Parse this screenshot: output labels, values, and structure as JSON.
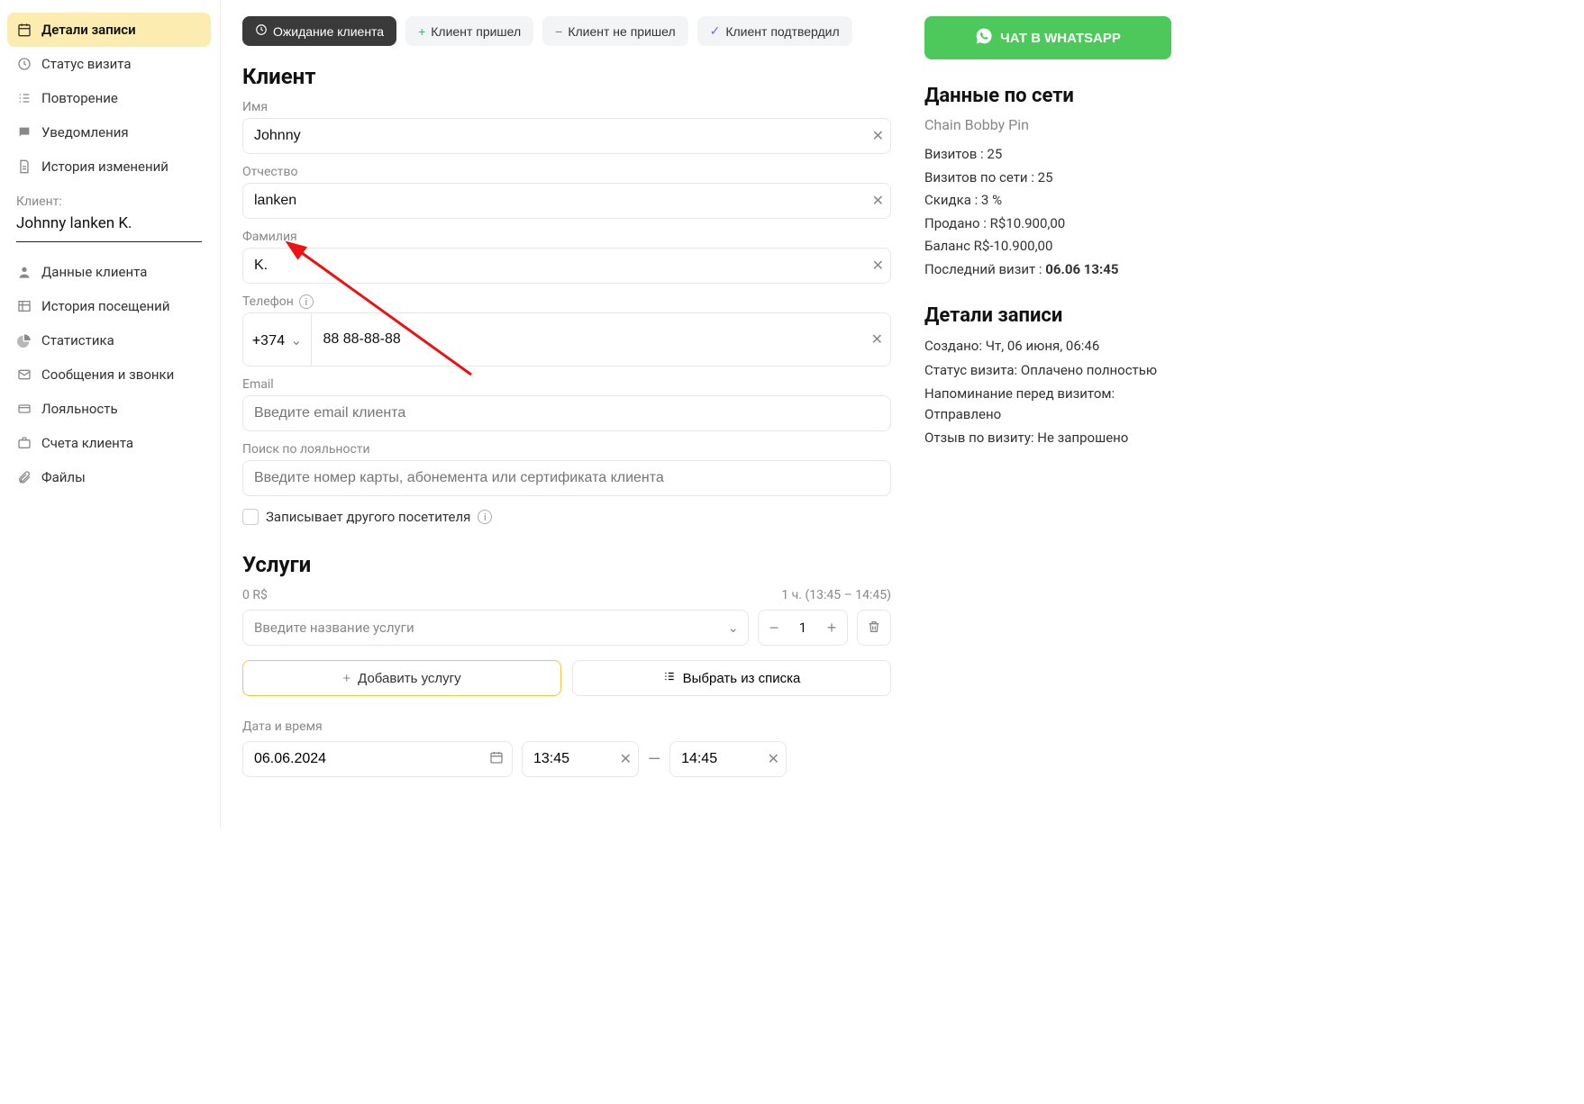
{
  "sidebar": {
    "items": [
      {
        "label": "Детали записи"
      },
      {
        "label": "Статус визита"
      },
      {
        "label": "Повторение"
      },
      {
        "label": "Уведомления"
      },
      {
        "label": "История изменений"
      }
    ],
    "client_label": "Клиент:",
    "client_name": "Johnny  lanken K.",
    "sub_items": [
      {
        "label": "Данные клиента"
      },
      {
        "label": "История посещений"
      },
      {
        "label": "Статистика"
      },
      {
        "label": "Сообщения и звонки"
      },
      {
        "label": "Лояльность"
      },
      {
        "label": "Счета клиента"
      },
      {
        "label": "Файлы"
      }
    ]
  },
  "status": {
    "waiting": "Ожидание клиента",
    "arrived": "Клиент пришел",
    "noshow": "Клиент не пришел",
    "confirmed": "Клиент подтвердил"
  },
  "client_section": {
    "heading": "Клиент",
    "name_label": "Имя",
    "name_value": "Johnny",
    "patronymic_label": "Отчество",
    "patronymic_value": "lanken",
    "surname_label": "Фамилия",
    "surname_value": "K.",
    "phone_label": "Телефон",
    "phone_code": "+374",
    "phone_value": "88 88-88-88",
    "email_label": "Email",
    "email_placeholder": "Введите email клиента",
    "loyalty_label": "Поиск по лояльности",
    "loyalty_placeholder": "Введите номер карты, абонемента или сертификата клиента",
    "records_other": "Записывает другого посетителя"
  },
  "services": {
    "heading": "Услуги",
    "price": "0 R$",
    "duration": "1 ч. (13:45 – 14:45)",
    "placeholder": "Введите название услуги",
    "qty": "1",
    "add": "Добавить услугу",
    "choose": "Выбрать из списка",
    "datetime_label": "Дата и время",
    "date": "06.06.2024",
    "time_from": "13:45",
    "time_to": "14:45"
  },
  "right": {
    "whatsapp": "ЧАТ В WHATSAPP",
    "network_heading": "Данные по сети",
    "chain": "Chain Bobby Pin",
    "stats": {
      "visits": "Визитов : 25",
      "visits_net": "Визитов по сети : 25",
      "discount": "Скидка : 3 %",
      "sold": "Продано : R$10.900,00",
      "balance": "Баланс R$-10.900,00",
      "last_label": "Последний визит : ",
      "last_value": "06.06 13:45"
    },
    "details_heading": "Детали записи",
    "details": {
      "created": "Создано: Чт, 06 июня, 06:46",
      "status": "Статус визита: Оплачено полностью",
      "reminder": "Напоминание перед визитом: Отправлено",
      "review": "Отзыв по визиту: Не запрошено"
    }
  }
}
